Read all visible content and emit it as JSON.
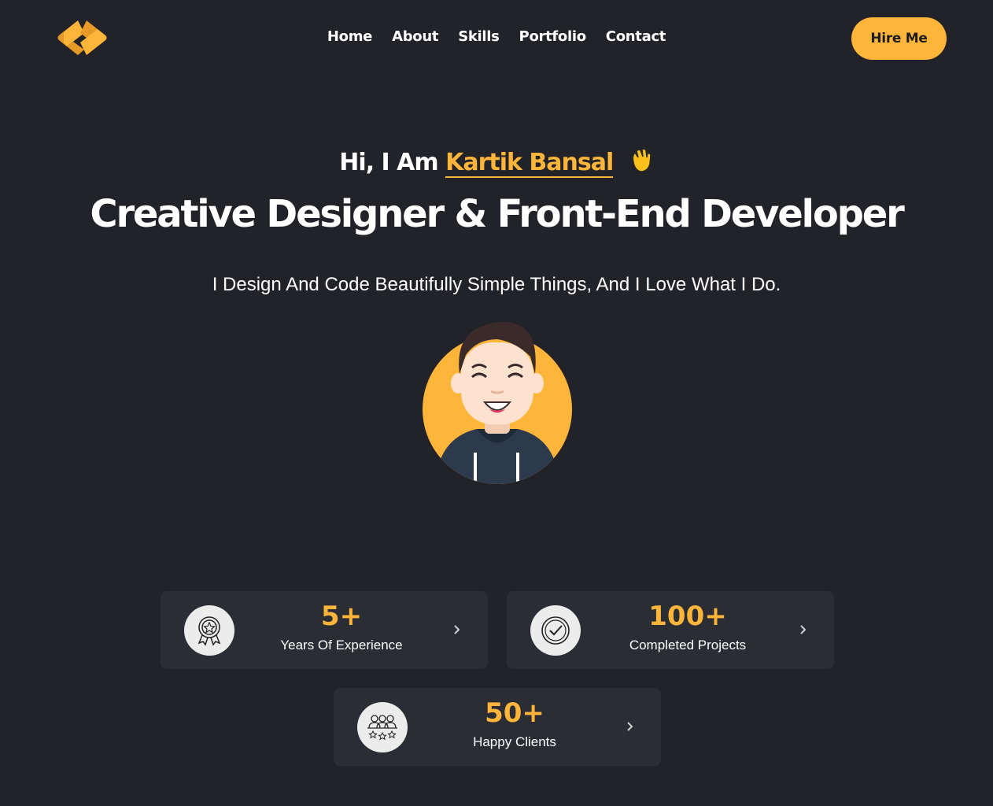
{
  "nav": {
    "links": [
      "Home",
      "About",
      "Skills",
      "Portfolio",
      "Contact"
    ],
    "hire_label": "Hire Me"
  },
  "hero": {
    "greeting_prefix": "Hi, I Am",
    "name": "Kartik Bansal",
    "headline": "Creative Designer & Front-End Developer",
    "tagline": "I Design And Code Beautifully Simple Things, And I Love What I Do."
  },
  "stats": [
    {
      "value": "5+",
      "label": "Years Of Experience",
      "icon": "award-badge-icon"
    },
    {
      "value": "100+",
      "label": "Completed Projects",
      "icon": "check-circle-icon"
    },
    {
      "value": "50+",
      "label": "Happy Clients",
      "icon": "clients-stars-icon"
    }
  ],
  "colors": {
    "background": "#212328",
    "accent": "#ffb43a",
    "card": "#2a2d33"
  }
}
